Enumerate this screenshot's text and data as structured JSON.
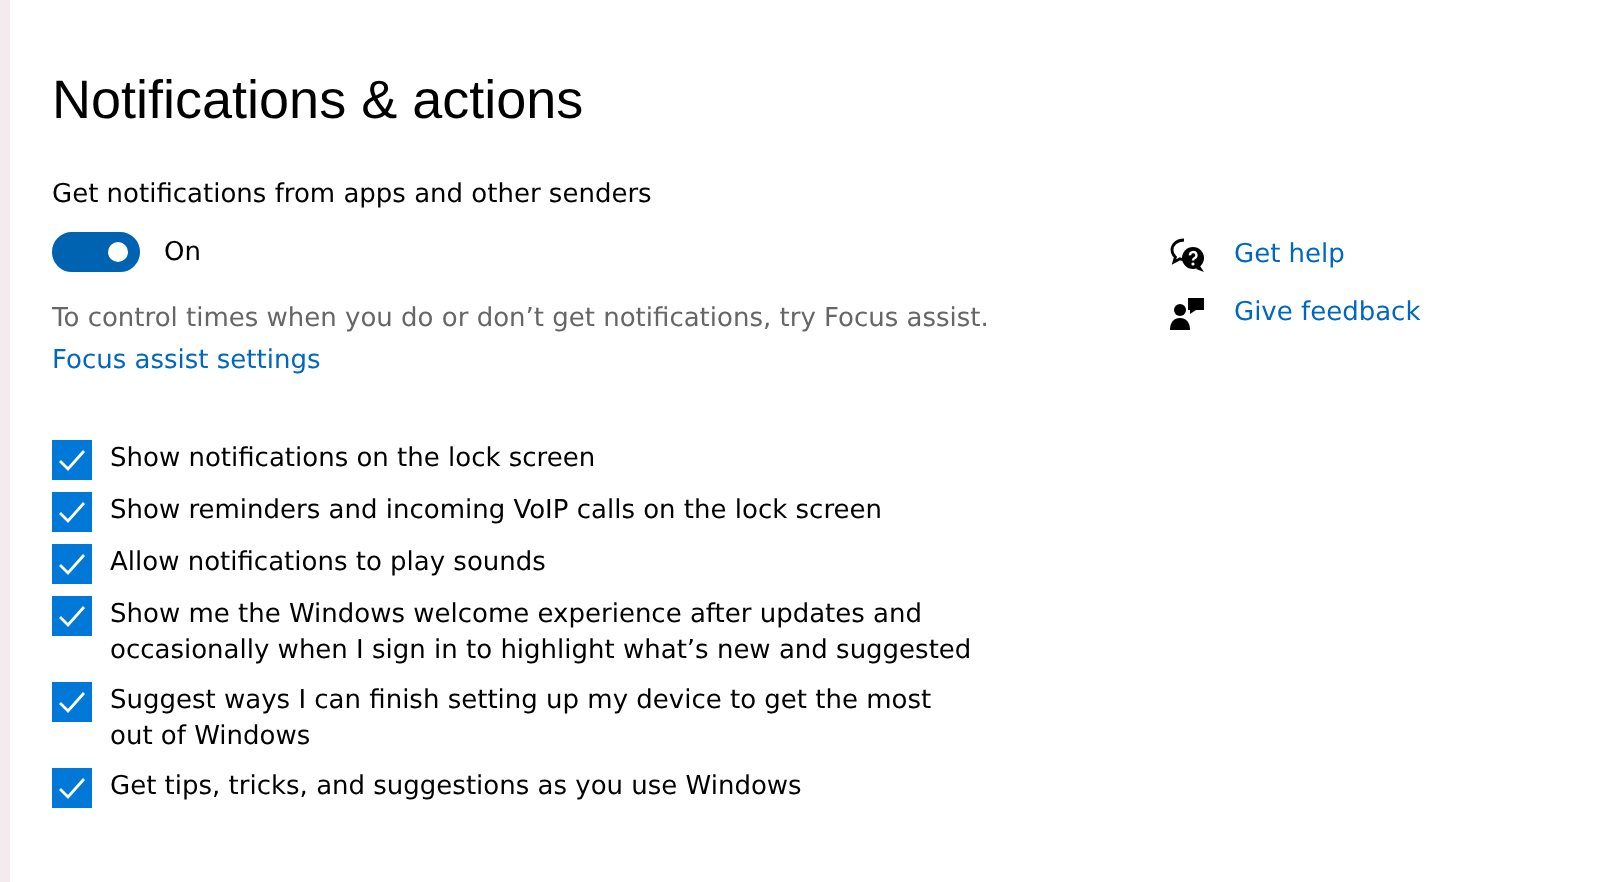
{
  "page": {
    "title": "Notifications & actions"
  },
  "notifications_toggle": {
    "label": "Get notifications from apps and other senders",
    "on": true,
    "state_text": "On"
  },
  "focus_note": "To control times when you do or don’t get notifications, try Focus assist.",
  "focus_link": "Focus assist settings",
  "options": [
    {
      "label": "Show notifications on the lock screen",
      "checked": true
    },
    {
      "label": "Show reminders and incoming VoIP calls on the lock screen",
      "checked": true
    },
    {
      "label": "Allow notifications to play sounds",
      "checked": true
    },
    {
      "label": "Show me the Windows welcome experience after updates and occasionally when I sign in to highlight what’s new and suggested",
      "checked": true
    },
    {
      "label": "Suggest ways I can finish setting up my device to get the most out of Windows",
      "checked": true
    },
    {
      "label": "Get tips, tricks, and suggestions as you use Windows",
      "checked": true
    }
  ],
  "side_links": [
    {
      "kind": "help",
      "label": "Get help"
    },
    {
      "kind": "feedback",
      "label": "Give feedback"
    }
  ]
}
